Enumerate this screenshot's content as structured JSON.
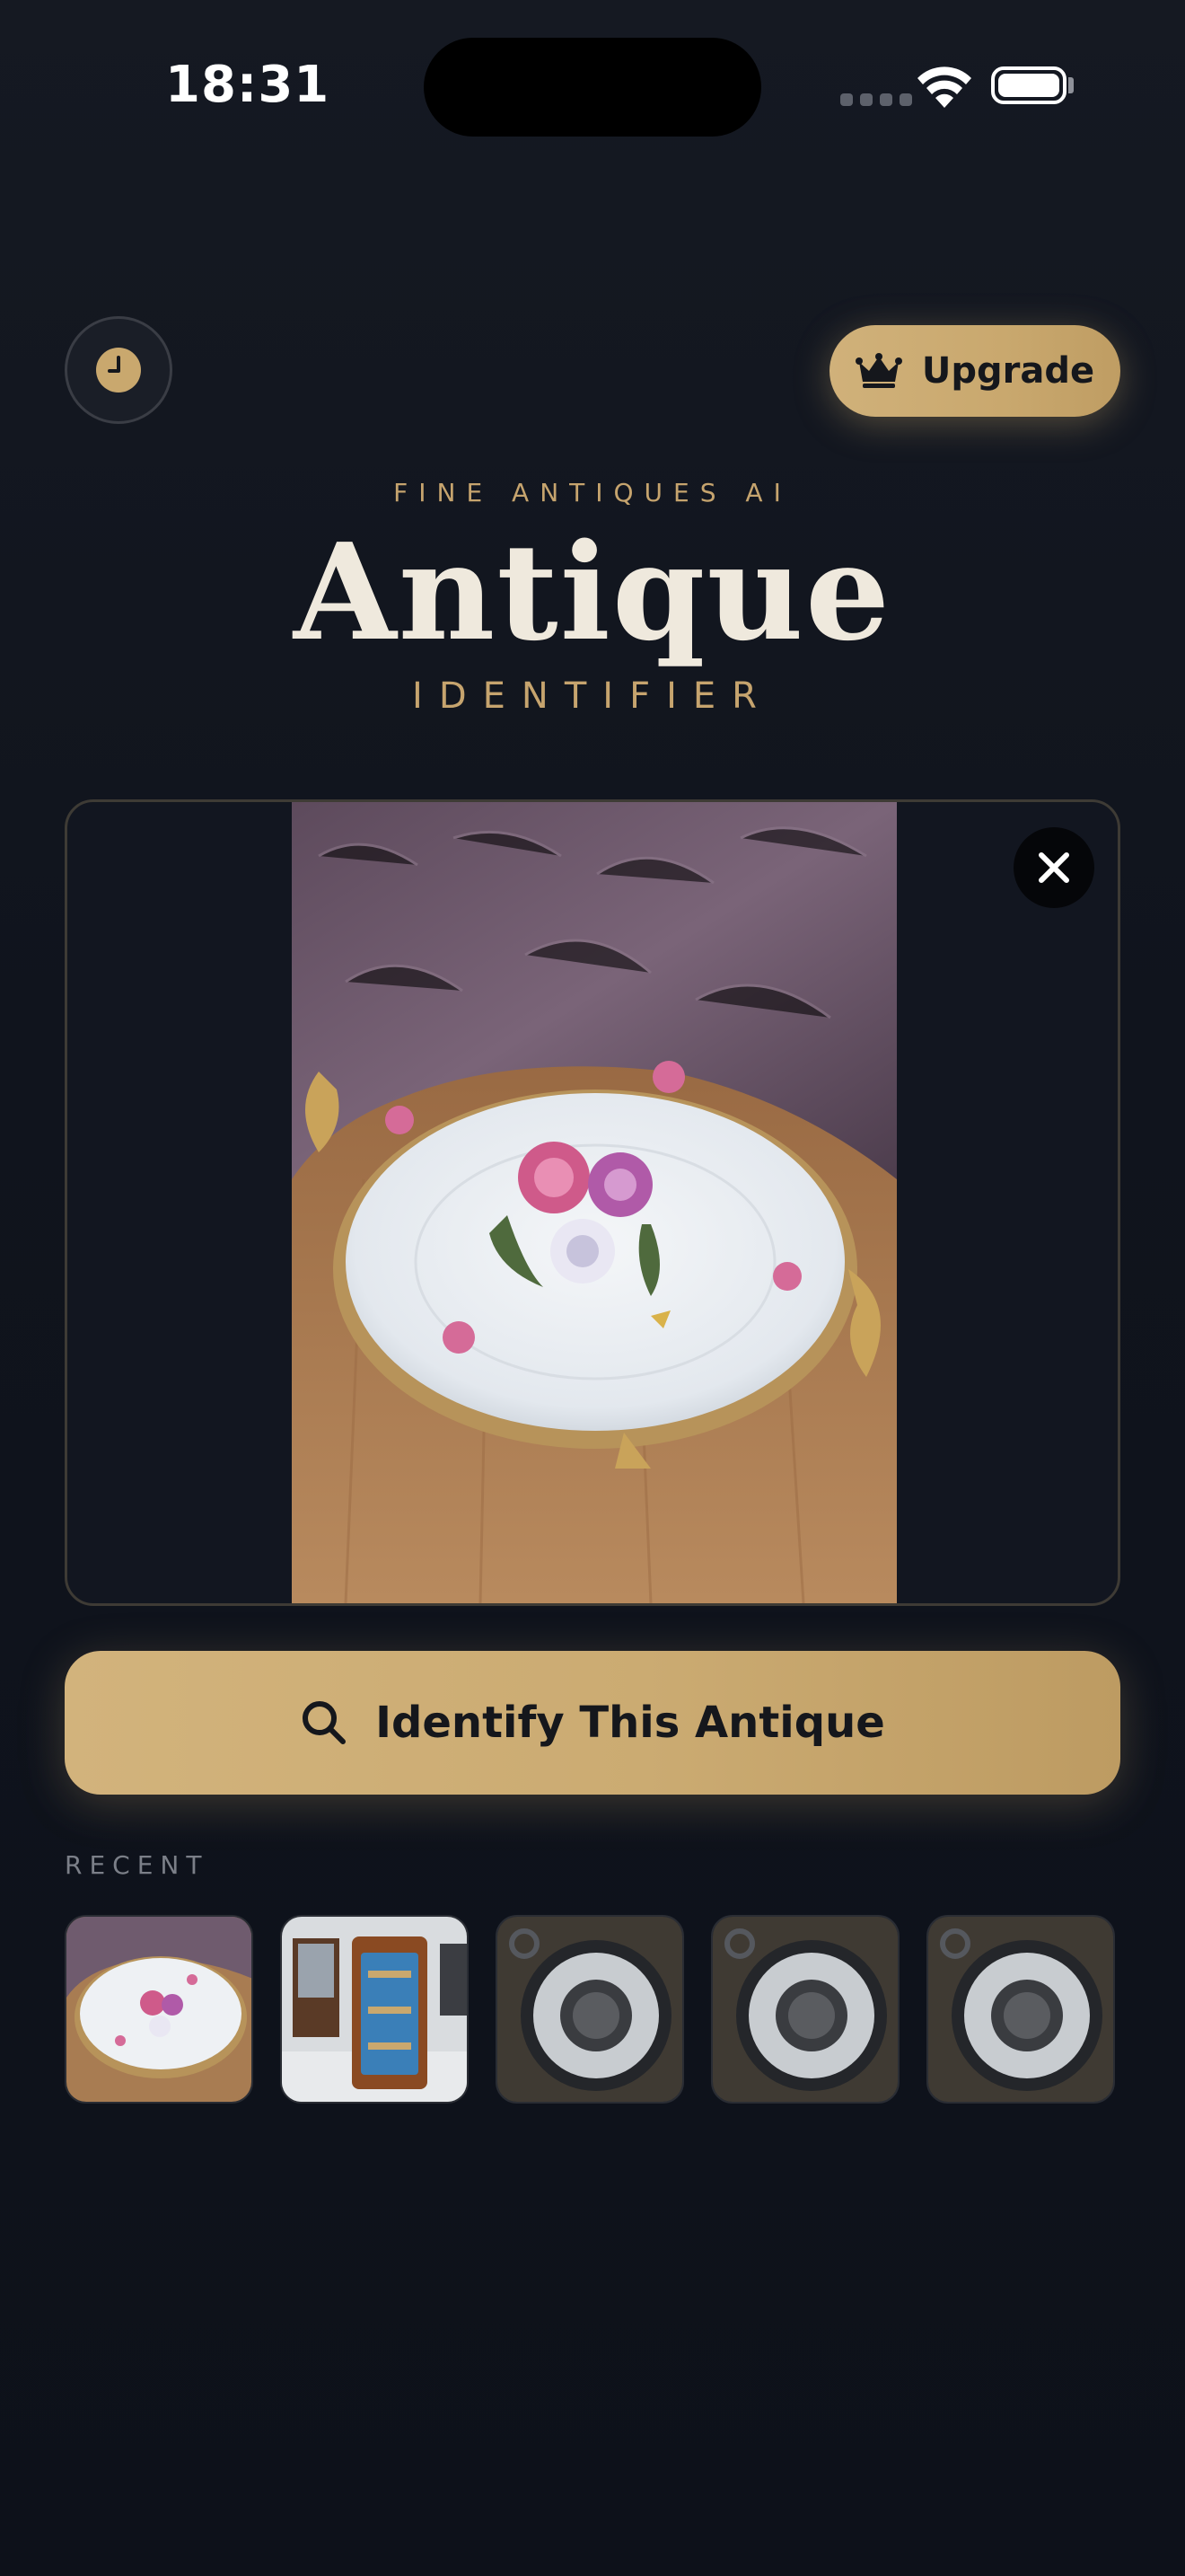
{
  "status_bar": {
    "time": "18:31"
  },
  "header": {
    "history_icon": "clock-icon",
    "upgrade_label": "Upgrade",
    "upgrade_icon": "crown-icon",
    "tagline": "FINE ANTIQUES AI",
    "title": "Antique",
    "subtitle": "IDENTIFIER"
  },
  "image_preview": {
    "subject": "porcelain-plate-photo",
    "close_icon": "close-icon"
  },
  "identify_button": {
    "label": "Identify This Antique",
    "icon": "search-icon"
  },
  "recent": {
    "label": "RECENT",
    "items": [
      {
        "subject": "porcelain-plate-photo"
      },
      {
        "subject": "display-cabinet-photo"
      },
      {
        "subject": "pocket-watch-photo"
      },
      {
        "subject": "pocket-watch-photo"
      },
      {
        "subject": "pocket-watch-photo"
      }
    ]
  },
  "colors": {
    "background": "#0f131c",
    "accent_gold": "#c9a86e",
    "title_cream": "#efe9dd",
    "muted_text": "#7b7f88"
  }
}
